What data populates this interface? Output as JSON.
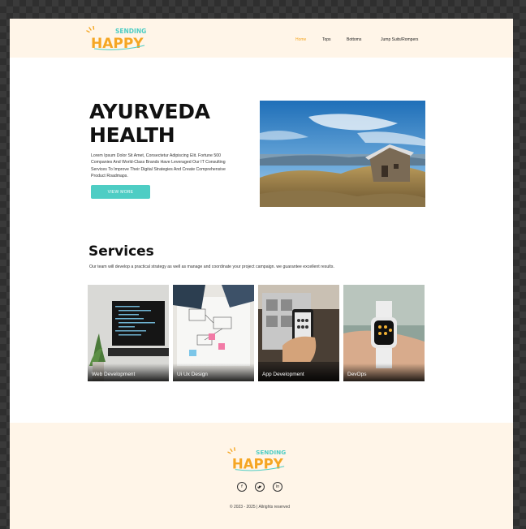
{
  "header": {
    "logo_text_top": "SENDING",
    "logo_text_main": "HAPPY",
    "nav": [
      {
        "label": "Home",
        "active": true
      },
      {
        "label": "Tops",
        "active": false
      },
      {
        "label": "Bottoms",
        "active": false
      },
      {
        "label": "Jump Suits/Rompers",
        "active": false
      }
    ]
  },
  "hero": {
    "title_line1": "AYURVEDA",
    "title_line2": "HEALTH",
    "description": "Lorem Ipsum Dolor Sit Amet, Consectetur Adipiscing Elit. Fortune 500 Companies And World-Class Brands Have Leveraged Our IT Consulting Services To Improve Their Digital Strategies And Create Comprehensive Product Roadmaps.",
    "button_label": "VIEW MORE"
  },
  "services": {
    "title": "Services",
    "description": "Our team will develop a practical strategy as well as manage and coordinate your project campaign. we guarantee excellent results.",
    "cards": [
      {
        "label": "Web Development"
      },
      {
        "label": "Ui Ux Design"
      },
      {
        "label": "App Development"
      },
      {
        "label": "DevOps"
      }
    ]
  },
  "footer": {
    "logo_text_top": "SENDING",
    "logo_text_main": "HAPPY",
    "social_icons": [
      "facebook-icon",
      "twitter-icon",
      "linkedin-icon"
    ],
    "copyright": "© 2023 - 2025 | Allrights reserved"
  },
  "colors": {
    "accent_orange": "#f5a623",
    "accent_teal": "#4ecdc4",
    "header_bg": "#fff5e8"
  }
}
